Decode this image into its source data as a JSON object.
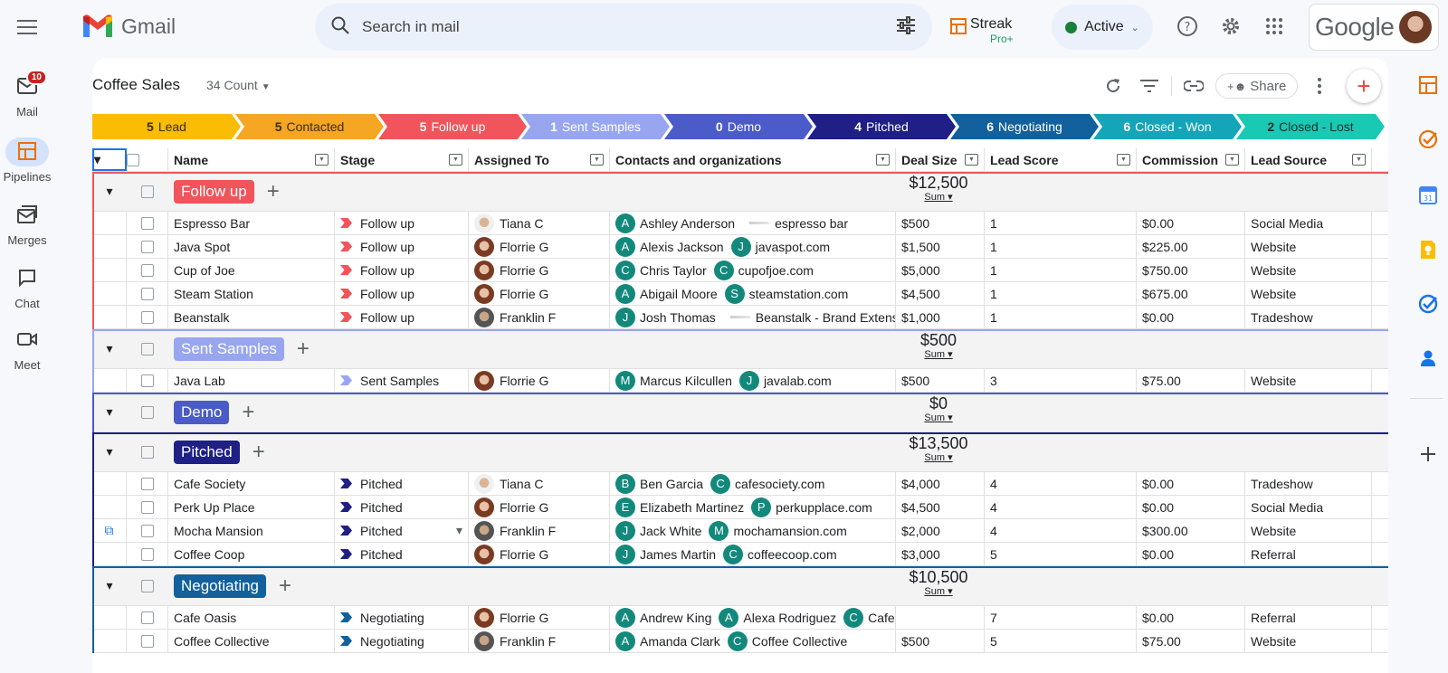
{
  "app": {
    "logo_text": "Gmail",
    "google_text": "Google"
  },
  "nav": {
    "menu_icon": "menu-icon",
    "items": [
      {
        "label": "Mail",
        "icon": "mail-icon",
        "badge": "10"
      },
      {
        "label": "Pipelines",
        "icon": "pipelines-icon",
        "active": true
      },
      {
        "label": "Merges",
        "icon": "merges-icon"
      },
      {
        "label": "Chat",
        "icon": "chat-icon"
      },
      {
        "label": "Meet",
        "icon": "meet-icon"
      }
    ]
  },
  "search": {
    "placeholder": "Search in mail"
  },
  "streak": {
    "name": "Streak",
    "plan": "Pro+"
  },
  "status": {
    "label": "Active",
    "color": "#188038"
  },
  "pipeline": {
    "title": "Coffee Sales",
    "count": "34 Count",
    "share_label": "Share",
    "stages": [
      {
        "count": "5",
        "name": "Lead",
        "color": "#fbbc04",
        "text": "#3c2d00"
      },
      {
        "count": "5",
        "name": "Contacted",
        "color": "#f5a623",
        "text": "#3c2d00"
      },
      {
        "count": "5",
        "name": "Follow up",
        "color": "#f2545b",
        "text": "#ffffff"
      },
      {
        "count": "1",
        "name": "Sent Samples",
        "color": "#98a6f0",
        "text": "#ffffff"
      },
      {
        "count": "0",
        "name": "Demo",
        "color": "#4b5bc7",
        "text": "#ffffff"
      },
      {
        "count": "4",
        "name": "Pitched",
        "color": "#1f1f85",
        "text": "#ffffff"
      },
      {
        "count": "6",
        "name": "Negotiating",
        "color": "#12619c",
        "text": "#ffffff"
      },
      {
        "count": "6",
        "name": "Closed - Won",
        "color": "#14a5b8",
        "text": "#ffffff"
      },
      {
        "count": "2",
        "name": "Closed - Lost",
        "color": "#19c9b4",
        "text": "#10302b"
      }
    ]
  },
  "columns": [
    "Name",
    "Stage",
    "Assigned To",
    "Contacts and organizations",
    "Deal Size",
    "Lead Score",
    "Commission",
    "Lead Source"
  ],
  "groups": [
    {
      "name": "Follow up",
      "color": "#f2545b",
      "sum": "$12,500",
      "sum_label": "Sum",
      "rows": [
        {
          "name": "Espresso Bar",
          "stage": "Follow up",
          "assigned": "Tiana C",
          "av": "t",
          "contacts": [
            {
              "i": "A",
              "n": "Ashley Anderson"
            }
          ],
          "org_plain": "espresso bar",
          "deal": "$500",
          "score": "1",
          "commission": "$0.00",
          "source": "Social Media"
        },
        {
          "name": "Java Spot",
          "stage": "Follow up",
          "assigned": "Florrie G",
          "av": "f",
          "contacts": [
            {
              "i": "A",
              "n": "Alexis Jackson"
            },
            {
              "i": "J",
              "n": "javaspot.com"
            }
          ],
          "deal": "$1,500",
          "score": "1",
          "commission": "$225.00",
          "source": "Website"
        },
        {
          "name": "Cup of Joe",
          "stage": "Follow up",
          "assigned": "Florrie G",
          "av": "f",
          "contacts": [
            {
              "i": "C",
              "n": "Chris Taylor"
            },
            {
              "i": "C",
              "n": "cupofjoe.com"
            }
          ],
          "deal": "$5,000",
          "score": "1",
          "commission": "$750.00",
          "source": "Website"
        },
        {
          "name": "Steam Station",
          "stage": "Follow up",
          "assigned": "Florrie G",
          "av": "f",
          "contacts": [
            {
              "i": "A",
              "n": "Abigail Moore"
            },
            {
              "i": "S",
              "n": "steamstation.com"
            }
          ],
          "deal": "$4,500",
          "score": "1",
          "commission": "$675.00",
          "source": "Website"
        },
        {
          "name": "Beanstalk",
          "stage": "Follow up",
          "assigned": "Franklin F",
          "av": "k",
          "contacts": [
            {
              "i": "J",
              "n": "Josh Thomas"
            }
          ],
          "org_plain": "Beanstalk - Brand Extensi",
          "deal": "$1,000",
          "score": "1",
          "commission": "$0.00",
          "source": "Tradeshow"
        }
      ]
    },
    {
      "name": "Sent Samples",
      "color": "#98a6f0",
      "sum": "$500",
      "sum_label": "Sum",
      "rows": [
        {
          "name": "Java Lab",
          "stage": "Sent Samples",
          "assigned": "Florrie G",
          "av": "f",
          "contacts": [
            {
              "i": "M",
              "n": "Marcus Kilcullen"
            },
            {
              "i": "J",
              "n": "javalab.com"
            }
          ],
          "deal": "$500",
          "score": "3",
          "commission": "$75.00",
          "source": "Website"
        }
      ]
    },
    {
      "name": "Demo",
      "color": "#4b5bc7",
      "sum": "$0",
      "sum_label": "Sum",
      "rows": []
    },
    {
      "name": "Pitched",
      "color": "#1f1f85",
      "sum": "$13,500",
      "sum_label": "Sum",
      "rows": [
        {
          "name": "Cafe Society",
          "stage": "Pitched",
          "assigned": "Tiana C",
          "av": "t",
          "contacts": [
            {
              "i": "B",
              "n": "Ben Garcia"
            },
            {
              "i": "C",
              "n": "cafesociety.com"
            }
          ],
          "deal": "$4,000",
          "score": "4",
          "commission": "$0.00",
          "source": "Tradeshow"
        },
        {
          "name": "Perk Up Place",
          "stage": "Pitched",
          "assigned": "Florrie G",
          "av": "f",
          "contacts": [
            {
              "i": "E",
              "n": "Elizabeth Martinez"
            },
            {
              "i": "P",
              "n": "perkupplace.com"
            }
          ],
          "deal": "$4,500",
          "score": "4",
          "commission": "$0.00",
          "source": "Social Media"
        },
        {
          "name": "Mocha Mansion",
          "stage": "Pitched",
          "assigned": "Franklin F",
          "av": "k",
          "contacts": [
            {
              "i": "J",
              "n": "Jack White"
            },
            {
              "i": "M",
              "n": "mochamansion.com"
            }
          ],
          "deal": "$2,000",
          "score": "4",
          "commission": "$300.00",
          "source": "Website",
          "hover": true
        },
        {
          "name": "Coffee Coop",
          "stage": "Pitched",
          "assigned": "Florrie G",
          "av": "f",
          "contacts": [
            {
              "i": "J",
              "n": "James Martin"
            },
            {
              "i": "C",
              "n": "coffeecoop.com"
            }
          ],
          "deal": "$3,000",
          "score": "5",
          "commission": "$0.00",
          "source": "Referral"
        }
      ]
    },
    {
      "name": "Negotiating",
      "color": "#12619c",
      "sum": "$10,500",
      "sum_label": "Sum",
      "rows": [
        {
          "name": "Cafe Oasis",
          "stage": "Negotiating",
          "assigned": "Florrie G",
          "av": "f",
          "contacts": [
            {
              "i": "A",
              "n": "Andrew King"
            },
            {
              "i": "A",
              "n": "Alexa Rodriguez"
            },
            {
              "i": "C",
              "n": "Cafe"
            }
          ],
          "deal": "",
          "score": "7",
          "commission": "$0.00",
          "source": "Referral"
        },
        {
          "name": "Coffee Collective",
          "stage": "Negotiating",
          "assigned": "Franklin F",
          "av": "k",
          "contacts": [
            {
              "i": "A",
              "n": "Amanda Clark"
            },
            {
              "i": "C",
              "n": "Coffee Collective"
            }
          ],
          "deal": "$500",
          "score": "5",
          "commission": "$75.00",
          "source": "Website"
        }
      ]
    }
  ],
  "side_apps": [
    "streak-icon",
    "tasks-check-icon",
    "calendar-icon",
    "keep-icon",
    "tasks-icon",
    "contacts-icon",
    "add-icon"
  ]
}
